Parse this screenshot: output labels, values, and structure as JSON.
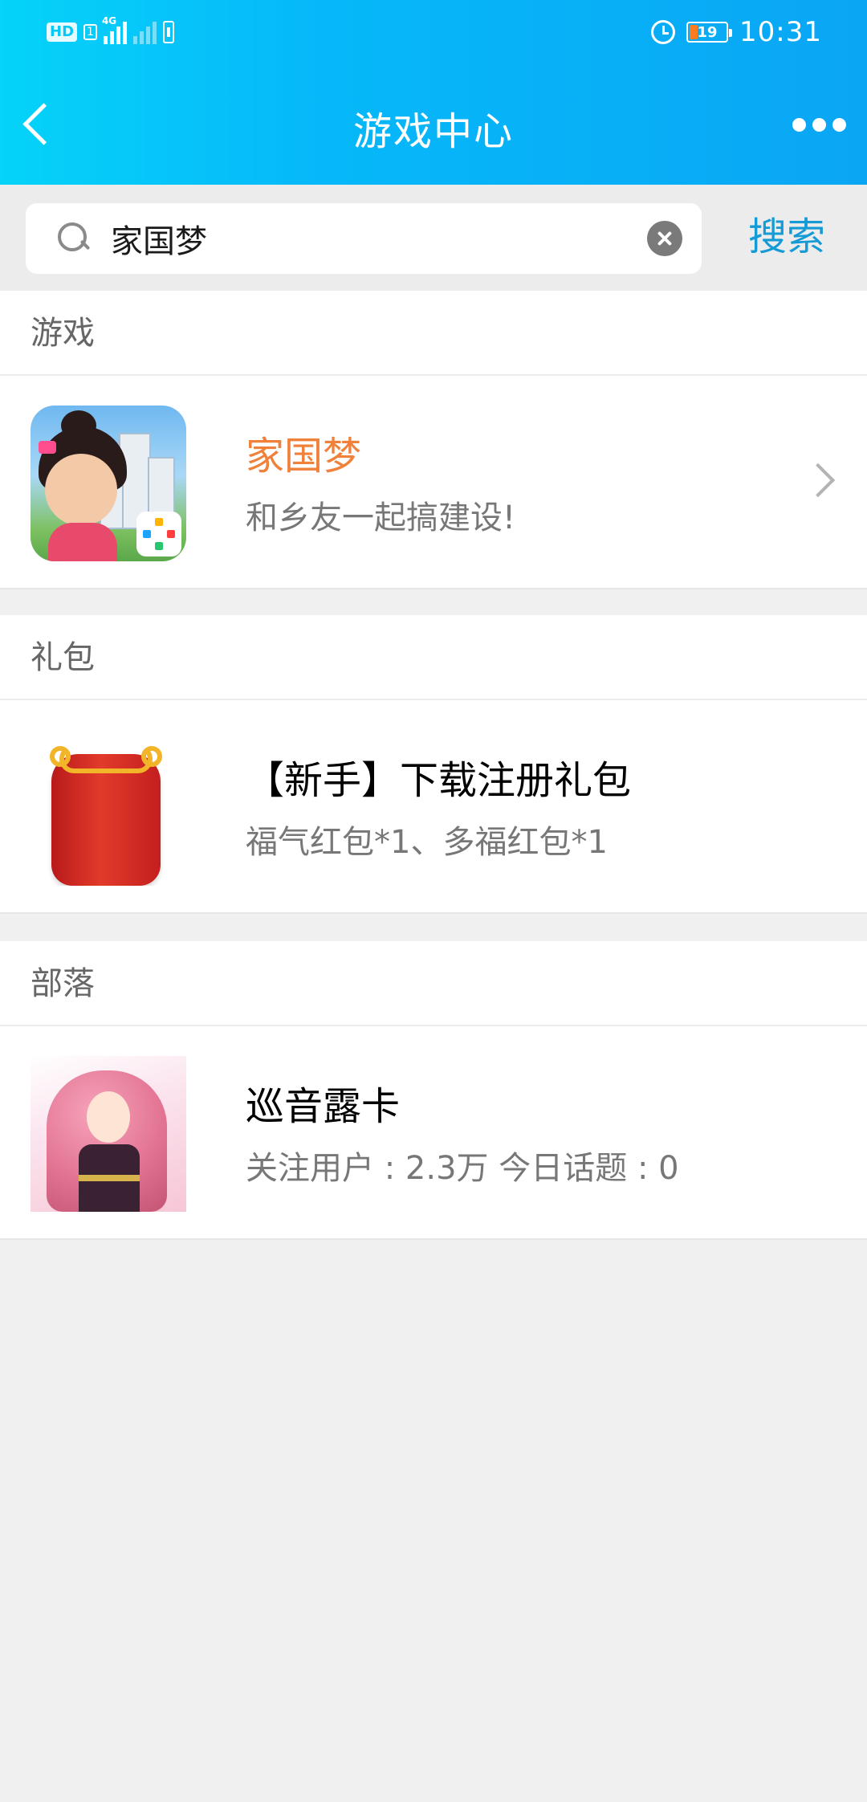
{
  "status_bar": {
    "hd_label": "HD",
    "sim_label": "1",
    "network_label": "4G",
    "battery_level": "19",
    "time": "10:31",
    "icons": [
      "signal-icon",
      "alarm-icon",
      "battery-icon"
    ]
  },
  "header": {
    "title": "游戏中心",
    "back_icon": "chevron-left-icon",
    "more_icon": "more-dots-icon",
    "gradient": [
      "#05d3f9",
      "#0aa6f4"
    ]
  },
  "search": {
    "value": "家国梦",
    "placeholder": "",
    "button_label": "搜索",
    "accent_color": "#149bd6"
  },
  "sections": {
    "games": {
      "heading": "游戏",
      "items": [
        {
          "title": "家国梦",
          "subtitle": "和乡友一起搞建设!",
          "title_color": "#f0813a"
        }
      ]
    },
    "gifts": {
      "heading": "礼包",
      "items": [
        {
          "title": "【新手】下载注册礼包",
          "subtitle": "福气红包*1、多福红包*1"
        }
      ]
    },
    "tribes": {
      "heading": "部落",
      "items": [
        {
          "title": "巡音露卡",
          "subtitle": "关注用户 : 2.3万 今日话题 : 0"
        }
      ]
    }
  }
}
